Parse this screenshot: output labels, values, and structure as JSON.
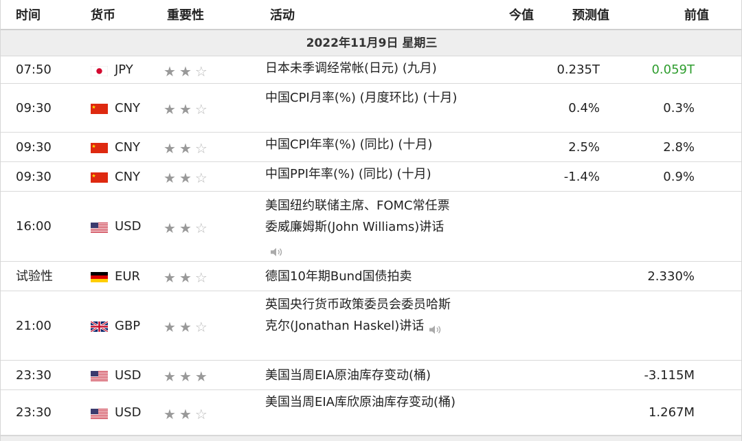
{
  "headers": {
    "time": "时间",
    "currency": "货币",
    "importance": "重要性",
    "event": "活动",
    "actual": "今值",
    "forecast": "预测值",
    "previous": "前值"
  },
  "date_label": "2022年11月9日 星期三",
  "rows": [
    {
      "time": "07:50",
      "flag": "jp-flag-icon",
      "currency": "JPY",
      "stars": 2,
      "event": "日本未季调经常帐(日元) (九月)",
      "speaker": false,
      "actual": "",
      "forecast": "0.235T",
      "previous": "0.059T",
      "previous_color": "#2e9d2e"
    },
    {
      "time": "09:30",
      "flag": "cn-flag-icon",
      "currency": "CNY",
      "stars": 2,
      "event": "中国CPI月率(%) (月度环比) (十月)",
      "speaker": false,
      "actual": "",
      "forecast": "0.4%",
      "previous": "0.3%",
      "previous_color": ""
    },
    {
      "time": "09:30",
      "flag": "cn-flag-icon",
      "currency": "CNY",
      "stars": 2,
      "event": "中国CPI年率(%) (同比) (十月)",
      "speaker": false,
      "actual": "",
      "forecast": "2.5%",
      "previous": "2.8%",
      "previous_color": ""
    },
    {
      "time": "09:30",
      "flag": "cn-flag-icon",
      "currency": "CNY",
      "stars": 2,
      "event": "中国PPI年率(%) (同比) (十月)",
      "speaker": false,
      "actual": "",
      "forecast": "-1.4%",
      "previous": "0.9%",
      "previous_color": ""
    },
    {
      "time": "16:00",
      "flag": "us-flag-icon",
      "currency": "USD",
      "stars": 2,
      "event": "美国纽约联储主席、FOMC常任票委威廉姆斯(John Williams)讲话",
      "speaker": true,
      "actual": "",
      "forecast": "",
      "previous": "",
      "previous_color": ""
    },
    {
      "time": "试验性",
      "flag": "de-flag-icon",
      "currency": "EUR",
      "stars": 2,
      "event": "德国10年期Bund国债拍卖",
      "speaker": false,
      "actual": "",
      "forecast": "",
      "previous": "2.330%",
      "previous_color": ""
    },
    {
      "time": "21:00",
      "flag": "gb-flag-icon",
      "currency": "GBP",
      "stars": 2,
      "event": "英国央行货币政策委员会委员哈斯克尔(Jonathan Haskel)讲话",
      "speaker": true,
      "actual": "",
      "forecast": "",
      "previous": "",
      "previous_color": ""
    },
    {
      "time": "23:30",
      "flag": "us-flag-icon",
      "currency": "USD",
      "stars": 3,
      "event": "美国当周EIA原油库存变动(桶)",
      "speaker": false,
      "actual": "",
      "forecast": "",
      "previous": "-3.115M",
      "previous_color": ""
    },
    {
      "time": "23:30",
      "flag": "us-flag-icon",
      "currency": "USD",
      "stars": 2,
      "event": "美国当周EIA库欣原油库存变动(桶)",
      "speaker": false,
      "actual": "",
      "forecast": "",
      "previous": "1.267M",
      "previous_color": ""
    }
  ]
}
